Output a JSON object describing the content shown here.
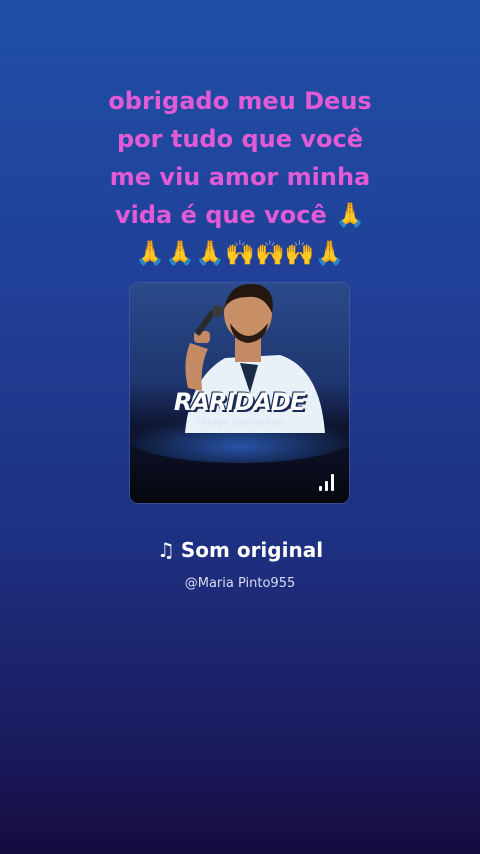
{
  "caption": {
    "lines": [
      "obrigado meu Deus",
      "por tudo que você",
      "me viu amor minha",
      "vida é que você 🙏",
      "🙏🙏🙏🙌🙌🙌🙏"
    ]
  },
  "album": {
    "title": "RARIDADE",
    "artist": "Thiago jhonathan",
    "icon": "audio-bars-icon"
  },
  "sound": {
    "note_icon": "♫",
    "title": "Som original",
    "user": "@Maria Pinto955"
  }
}
